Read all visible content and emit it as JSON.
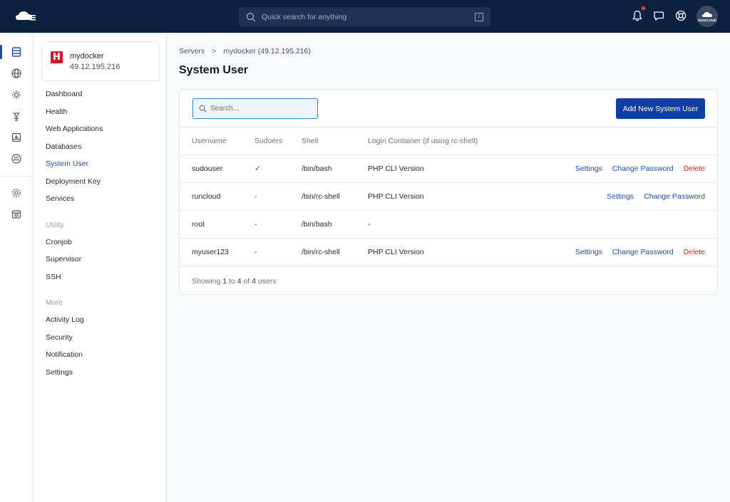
{
  "topbar": {
    "search_placeholder": "Quick search for anything",
    "search_shortcut": "/",
    "avatar_label": "RUNCLOUD"
  },
  "server": {
    "name": "mydocker",
    "ip": "49.12.195.216",
    "logo_letter": "H"
  },
  "sidebar": {
    "items": [
      {
        "label": "Dashboard"
      },
      {
        "label": "Health"
      },
      {
        "label": "Web Applications"
      },
      {
        "label": "Databases"
      },
      {
        "label": "System User"
      },
      {
        "label": "Deployment Key"
      },
      {
        "label": "Services"
      }
    ],
    "utility_heading": "Utility",
    "utility": [
      {
        "label": "Cronjob"
      },
      {
        "label": "Supervisor"
      },
      {
        "label": "SSH"
      }
    ],
    "more_heading": "More",
    "more": [
      {
        "label": "Activity Log"
      },
      {
        "label": "Security"
      },
      {
        "label": "Notification"
      },
      {
        "label": "Settings"
      }
    ]
  },
  "breadcrumb": {
    "root": "Servers",
    "separator": ">",
    "current": "mydocker (49.12.195.216)"
  },
  "page": {
    "title": "System User",
    "search_placeholder": "Search...",
    "add_button": "Add New System User"
  },
  "table": {
    "columns": [
      "Username",
      "Sudoers",
      "Shell",
      "Login Container (if using rc-shell)"
    ],
    "rows": [
      {
        "username": "sudouser",
        "sudoers": "✓",
        "shell": "/bin/bash",
        "login": "PHP CLI Version",
        "settings": "Settings",
        "change_password": "Change Password",
        "delete": "Delete"
      },
      {
        "username": "runcloud",
        "sudoers": "-",
        "shell": "/bin/rc-shell",
        "login": "PHP CLI Version",
        "settings": "Settings",
        "change_password": "Change Password"
      },
      {
        "username": "root",
        "sudoers": "-",
        "shell": "/bin/bash",
        "login": "-"
      },
      {
        "username": "myuser123",
        "sudoers": "-",
        "shell": "/bin/rc-shell",
        "login": "PHP CLI Version",
        "settings": "Settings",
        "change_password": "Change Password",
        "delete": "Delete"
      }
    ]
  },
  "footer": {
    "prefix": "Showing",
    "from": "1",
    "to_word": "to",
    "to": "4",
    "of_word": "of",
    "total": "4",
    "suffix": "users"
  },
  "colors": {
    "topbar": "#0b2140",
    "accent": "#1d4fa8",
    "button": "#0f3fa3",
    "danger": "#dc2626"
  }
}
